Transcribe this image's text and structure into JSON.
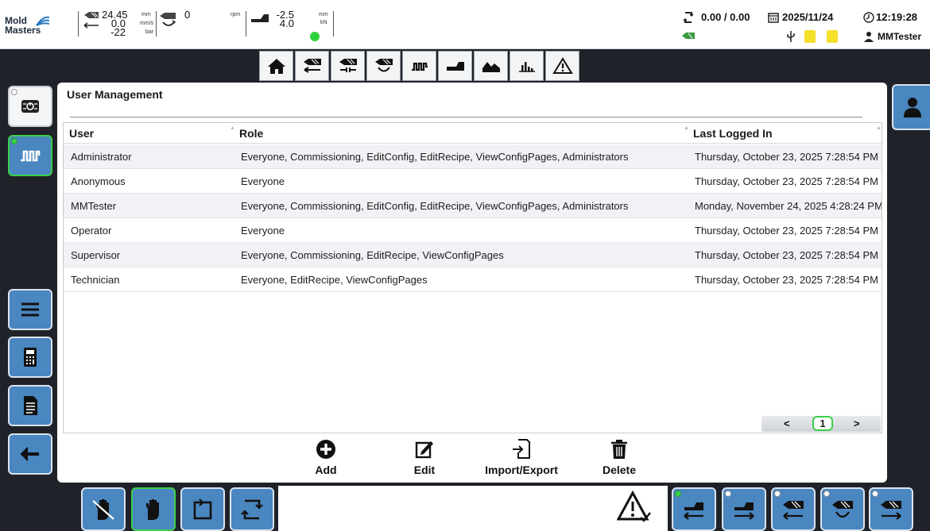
{
  "header": {
    "logo_line1": "Mold",
    "logo_line2": "Masters",
    "injection": {
      "v1": "24.45",
      "v2": "0.0",
      "v3": "-22",
      "u1": "mm",
      "u2": "mm/s",
      "u3": "bar"
    },
    "screw": {
      "v1": "0",
      "u1": "rpm"
    },
    "clamp": {
      "v1": "-2.5",
      "v2": "4.0",
      "u1": "mm",
      "u2": "kN"
    },
    "cycle": "0.00 / 0.00",
    "date": "2025/11/24",
    "time": "12:19:28",
    "user": "MMTester"
  },
  "nav_icons": [
    "home-icon",
    "injection-icon",
    "hold-icon",
    "screw-icon",
    "temperature-icon",
    "clamp-icon",
    "graph-icon",
    "chart-icon",
    "warning-icon"
  ],
  "panel": {
    "title": "User Management",
    "columns": {
      "user": "User",
      "role": "Role",
      "last": "Last Logged In"
    },
    "rows": [
      {
        "user": "Administrator",
        "role": "Everyone, Commissioning, EditConfig, EditRecipe, ViewConfigPages, Administrators",
        "last": "Thursday, October 23, 2025 7:28:54 PM"
      },
      {
        "user": "Anonymous",
        "role": "Everyone",
        "last": "Thursday, October 23, 2025 7:28:54 PM"
      },
      {
        "user": "MMTester",
        "role": "Everyone, Commissioning, EditConfig, EditRecipe, ViewConfigPages, Administrators",
        "last": "Monday, November 24, 2025 4:28:24 PM"
      },
      {
        "user": "Operator",
        "role": "Everyone",
        "last": "Thursday, October 23, 2025 7:28:54 PM"
      },
      {
        "user": "Supervisor",
        "role": "Everyone, Commissioning, EditRecipe, ViewConfigPages",
        "last": "Thursday, October 23, 2025 7:28:54 PM"
      },
      {
        "user": "Technician",
        "role": "Everyone, EditRecipe, ViewConfigPages",
        "last": "Thursday, October 23, 2025 7:28:54 PM"
      }
    ],
    "pager": {
      "prev": "<",
      "page": "1",
      "next": ">"
    },
    "actions": {
      "add": "Add",
      "edit": "Edit",
      "import_export": "Import/Export",
      "delete": "Delete"
    }
  },
  "colors": {
    "accent_blue": "#4a86c0",
    "active_green": "#3cd04a",
    "background": "#1f2228"
  }
}
